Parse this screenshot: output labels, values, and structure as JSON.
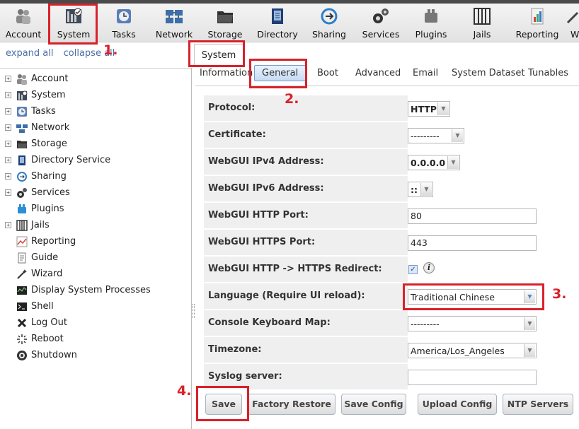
{
  "toolbar": {
    "items": [
      {
        "label": "Account",
        "icon": "account-icon"
      },
      {
        "label": "System",
        "icon": "system-icon"
      },
      {
        "label": "Tasks",
        "icon": "tasks-icon"
      },
      {
        "label": "Network",
        "icon": "network-icon"
      },
      {
        "label": "Storage",
        "icon": "storage-icon"
      },
      {
        "label": "Directory",
        "icon": "directory-icon"
      },
      {
        "label": "Sharing",
        "icon": "sharing-icon"
      },
      {
        "label": "Services",
        "icon": "services-icon"
      },
      {
        "label": "Plugins",
        "icon": "plugins-icon"
      },
      {
        "label": "Jails",
        "icon": "jails-icon"
      },
      {
        "label": "Reporting",
        "icon": "reporting-icon"
      },
      {
        "label": "W",
        "icon": "wizard-icon"
      }
    ]
  },
  "tree_controls": {
    "expand": "expand all",
    "collapse": "collapse all"
  },
  "tree": {
    "items": [
      {
        "label": "Account",
        "expandable": true
      },
      {
        "label": "System",
        "expandable": true
      },
      {
        "label": "Tasks",
        "expandable": true
      },
      {
        "label": "Network",
        "expandable": true
      },
      {
        "label": "Storage",
        "expandable": true
      },
      {
        "label": "Directory Service",
        "expandable": true
      },
      {
        "label": "Sharing",
        "expandable": true
      },
      {
        "label": "Services",
        "expandable": true
      },
      {
        "label": "Plugins",
        "expandable": false
      },
      {
        "label": "Jails",
        "expandable": true
      },
      {
        "label": "Reporting",
        "expandable": false
      },
      {
        "label": "Guide",
        "expandable": false
      },
      {
        "label": "Wizard",
        "expandable": false
      },
      {
        "label": "Display System Processes",
        "expandable": false
      },
      {
        "label": "Shell",
        "expandable": false
      },
      {
        "label": "Log Out",
        "expandable": false
      },
      {
        "label": "Reboot",
        "expandable": false
      },
      {
        "label": "Shutdown",
        "expandable": false
      }
    ],
    "expand_symbol": "+"
  },
  "main_tab": "System",
  "subtabs": [
    "Information",
    "General",
    "Boot",
    "Advanced",
    "Email",
    "System Dataset",
    "Tunables"
  ],
  "form": {
    "protocol": {
      "label": "Protocol:",
      "value": "HTTP"
    },
    "certificate": {
      "label": "Certificate:",
      "value": "---------"
    },
    "ipv4": {
      "label": "WebGUI IPv4 Address:",
      "value": "0.0.0.0"
    },
    "ipv6": {
      "label": "WebGUI IPv6 Address:",
      "value": "::"
    },
    "http_port": {
      "label": "WebGUI HTTP Port:",
      "value": "80"
    },
    "https_port": {
      "label": "WebGUI HTTPS Port:",
      "value": "443"
    },
    "redirect": {
      "label": "WebGUI HTTP -> HTTPS Redirect:",
      "checked": true,
      "check_glyph": "✓",
      "info_glyph": "i"
    },
    "language": {
      "label": "Language (Require UI reload):",
      "value": "Traditional Chinese"
    },
    "keymap": {
      "label": "Console Keyboard Map:",
      "value": "---------"
    },
    "timezone": {
      "label": "Timezone:",
      "value": "America/Los_Angeles"
    },
    "syslog": {
      "label": "Syslog server:",
      "value": ""
    }
  },
  "buttons": {
    "save": "Save",
    "factory_restore": "Factory Restore",
    "save_config": "Save Config",
    "upload_config": "Upload Config",
    "ntp_servers": "NTP Servers"
  },
  "annotations": [
    "1.",
    "2.",
    "3.",
    "4."
  ],
  "colors": {
    "annotation_red": "#d9212a",
    "link_blue": "#4a6fa5",
    "active_tab": "#c6dbf3"
  }
}
